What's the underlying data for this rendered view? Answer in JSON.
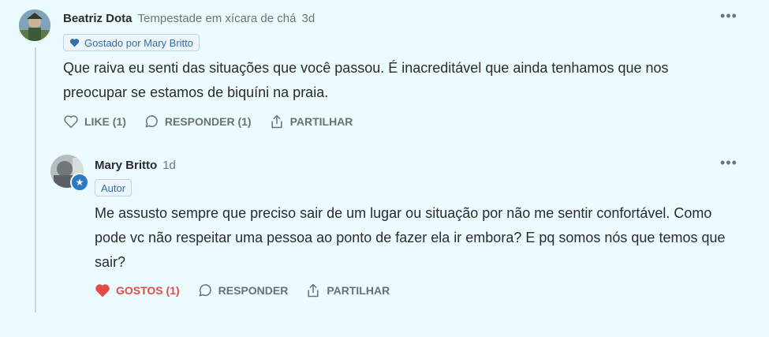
{
  "comment": {
    "author": "Beatriz Dota",
    "publication": "Tempestade em xícara de chá",
    "date": "3d",
    "liked_badge": "Gostado por Mary Britto",
    "text": "Que raiva eu senti das situações que você passou. É inacreditável que ainda tenhamos que nos preocupar se estamos de biquíni na praia.",
    "actions": {
      "like": "LIKE (1)",
      "reply": "RESPONDER (1)",
      "share": "PARTILHAR"
    }
  },
  "reply": {
    "author": "Mary Britto",
    "date": "1d",
    "role_badge": "Autor",
    "text": "Me assusto sempre que preciso sair de um lugar ou situação por não me sentir confortável. Como pode vc não respeitar uma pessoa ao ponto de fazer ela ir embora? E pq somos nós que temos que sair?",
    "actions": {
      "like": "GOSTOS (1)",
      "reply": "RESPONDER",
      "share": "PARTILHAR"
    }
  },
  "colors": {
    "background": "#ecfbfd",
    "badge_blue": "#2f6fab",
    "liked_red": "#e24b4b"
  },
  "icons": [
    "more-icon",
    "heart-icon",
    "comment-icon",
    "share-icon",
    "star-icon"
  ]
}
